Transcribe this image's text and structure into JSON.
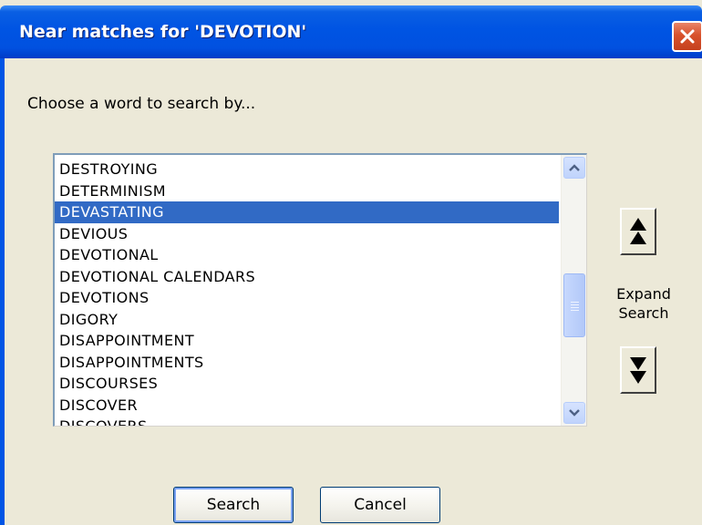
{
  "window": {
    "title": "Near matches for 'DEVOTION'"
  },
  "prompt": "Choose a word to search by...",
  "list": {
    "items": [
      "DESTROYING",
      "DETERMINISM",
      "DEVASTATING",
      "DEVIOUS",
      "DEVOTIONAL",
      "DEVOTIONAL CALENDARS",
      "DEVOTIONS",
      "DIGORY",
      "DISAPPOINTMENT",
      "DISAPPOINTMENTS",
      "DISCOURSES",
      "DISCOVER",
      "DISCOVERS"
    ],
    "selected_index": 2
  },
  "expand": {
    "label_line1": "Expand",
    "label_line2": "Search"
  },
  "buttons": {
    "search_label": "Search",
    "cancel_label": "Cancel"
  },
  "icons": {
    "close": "close-icon",
    "scroll_up": "chevron-up-icon",
    "scroll_down": "chevron-down-icon",
    "expand_up": "double-up-arrow-icon",
    "expand_down": "double-down-arrow-icon"
  },
  "colors": {
    "titlebar": "#0054e3",
    "selection": "#316ac5",
    "dialog_bg": "#ece9d8",
    "close_button": "#d8522c"
  }
}
